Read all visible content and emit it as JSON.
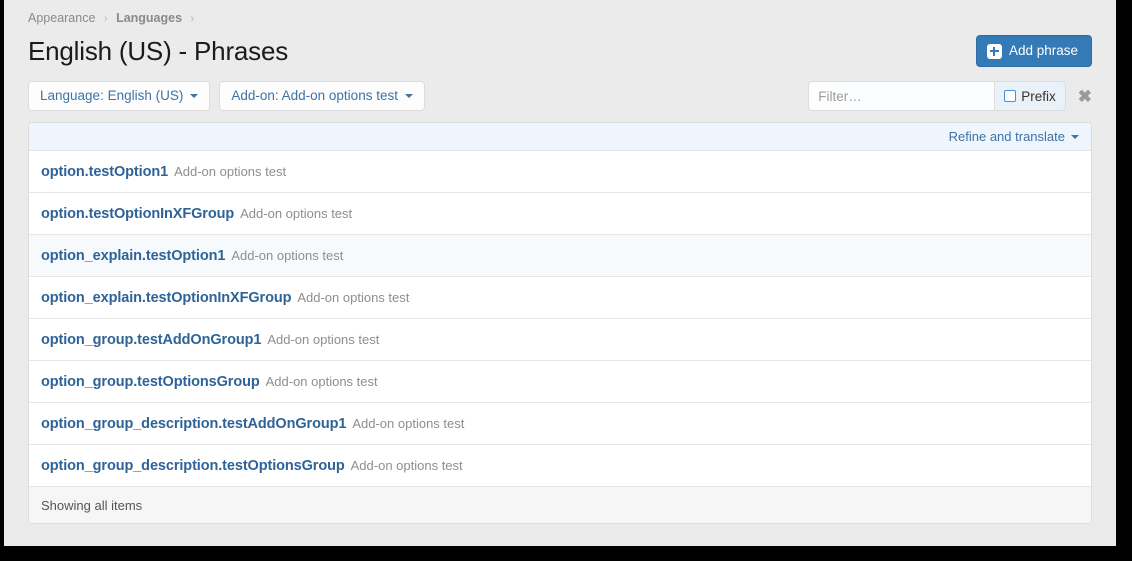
{
  "breadcrumb": {
    "items": [
      {
        "label": "Appearance",
        "strong": false
      },
      {
        "label": "Languages",
        "strong": true
      }
    ],
    "separator": "›"
  },
  "header": {
    "title": "English (US) - Phrases",
    "add_button_label": "Add phrase",
    "add_button_icon": "plus-square-icon",
    "accent_color": "#337ab7"
  },
  "filters": {
    "language_button_label": "Language: English (US)",
    "addon_button_label": "Add-on: Add-on options test",
    "search_placeholder": "Filter…",
    "search_value": "",
    "prefix_label": "Prefix",
    "prefix_checked": false,
    "clear_icon": "close-x-icon",
    "clear_glyph": "✖"
  },
  "list": {
    "refine_link_label": "Refine and translate",
    "rows": [
      {
        "phrase": "option.testOption1",
        "suffix": "Add-on options test"
      },
      {
        "phrase": "option.testOptionInXFGroup",
        "suffix": "Add-on options test"
      },
      {
        "phrase": "option_explain.testOption1",
        "suffix": "Add-on options test"
      },
      {
        "phrase": "option_explain.testOptionInXFGroup",
        "suffix": "Add-on options test"
      },
      {
        "phrase": "option_group.testAddOnGroup1",
        "suffix": "Add-on options test"
      },
      {
        "phrase": "option_group.testOptionsGroup",
        "suffix": "Add-on options test"
      },
      {
        "phrase": "option_group_description.testAddOnGroup1",
        "suffix": "Add-on options test"
      },
      {
        "phrase": "option_group_description.testOptionsGroup",
        "suffix": "Add-on options test"
      }
    ],
    "footer_text": "Showing all items"
  }
}
